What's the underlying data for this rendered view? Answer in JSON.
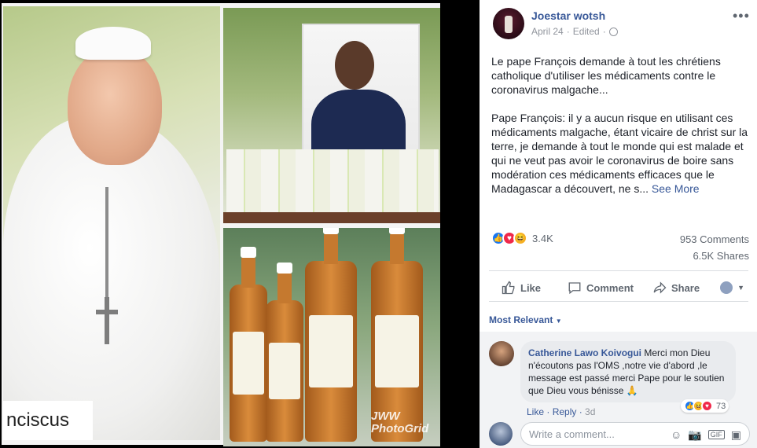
{
  "photo": {
    "caption": "nciscus",
    "watermark_line1": "JWW",
    "watermark_line2": "PhotoGrid"
  },
  "post": {
    "author": "Joestar wotsh",
    "date": "April 24",
    "edited": "Edited",
    "more_icon": "ellipsis-icon",
    "paragraph1": "Le pape François demande à tout les chrétiens catholique d'utiliser les médicaments contre le coronavirus malgache...",
    "paragraph2": "Pape François: il y a aucun risque en utilisant ces médicaments malgache, étant vicaire de christ sur la terre, je demande à tout le monde qui est malade et qui ne veut pas avoir le coronavirus de boire sans modération ces médicaments efficaces que le Madagascar a découvert, ne s...",
    "see_more": "See More"
  },
  "stats": {
    "reactions_count": "3.4K",
    "comments": "953 Comments",
    "shares": "6.5K Shares"
  },
  "actions": {
    "like": "Like",
    "comment": "Comment",
    "share": "Share"
  },
  "comments": {
    "sort_label": "Most Relevant",
    "items": [
      {
        "name": "Catherine Lawo Koivogui",
        "text": "Merci mon Dieu n'écoutons pas l'OMS ,notre vie d'abord ,le message est passé merci Pape pour le soutien que Dieu vous bénisse 🙏",
        "like": "Like",
        "reply": "Reply",
        "time": "3d",
        "reaction_count": "73"
      }
    ],
    "write_placeholder": "Write a comment..."
  }
}
